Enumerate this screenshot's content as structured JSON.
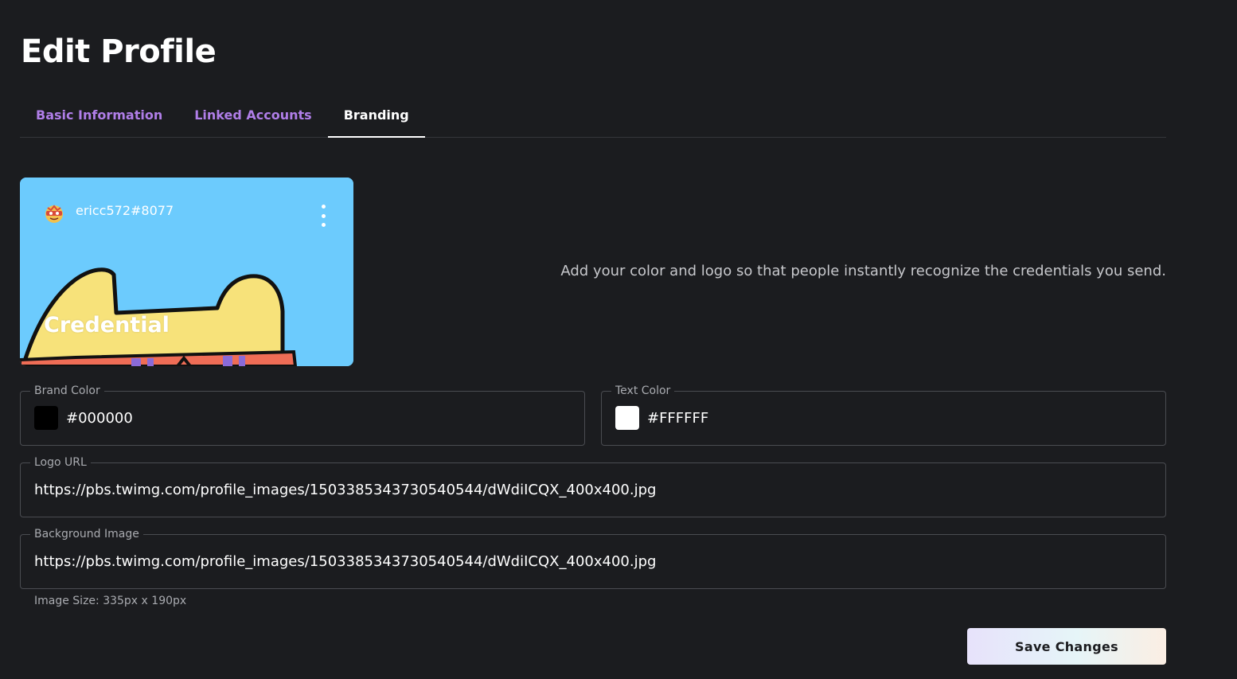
{
  "page": {
    "title": "Edit Profile"
  },
  "tabs": [
    {
      "label": "Basic Information",
      "active": false
    },
    {
      "label": "Linked Accounts",
      "active": false
    },
    {
      "label": "Branding",
      "active": true
    }
  ],
  "card": {
    "username": "ericc572#8077",
    "title": "Credential",
    "background_color": "#6ccbfd"
  },
  "description": "Add your color and logo so that people instantly recognize the credentials you send.",
  "fields": {
    "brand_color": {
      "label": "Brand Color",
      "value": "#000000"
    },
    "text_color": {
      "label": "Text Color",
      "value": "#FFFFFF"
    },
    "logo_url": {
      "label": "Logo URL",
      "value": "https://pbs.twimg.com/profile_images/1503385343730540544/dWdiICQX_400x400.jpg"
    },
    "background_image": {
      "label": "Background Image",
      "value": "https://pbs.twimg.com/profile_images/1503385343730540544/dWdiICQX_400x400.jpg"
    }
  },
  "helper_text": "Image Size: 335px x 190px",
  "actions": {
    "save_label": "Save Changes"
  },
  "colors": {
    "accent": "#b07ee8",
    "background": "#1b1c1f"
  }
}
